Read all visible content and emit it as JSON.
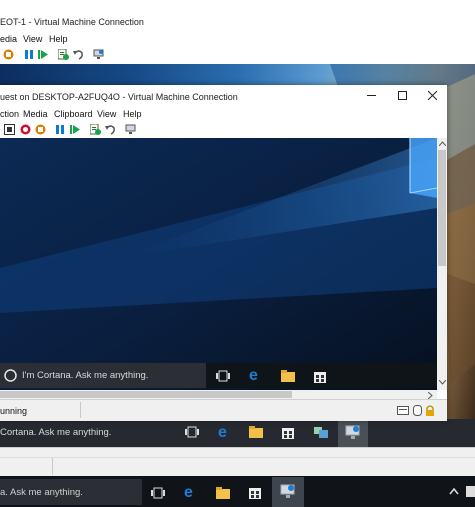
{
  "outer": {
    "title": "EOT-1 - Virtual Machine Connection",
    "menu": [
      "edia",
      "View",
      "Help"
    ],
    "taskbar": {
      "search_text": "Cortana. Ask me anything."
    }
  },
  "inner": {
    "title": "uest on DESKTOP-A2FUQ4O - Virtual Machine Connection",
    "menu": [
      "ction",
      "Media",
      "Clipboard",
      "View",
      "Help"
    ],
    "taskbar": {
      "search_text": "I'm Cortana. Ask me anything."
    },
    "status": "unning"
  },
  "host_taskbar": {
    "search_text": "a. Ask me anything."
  },
  "colors": {
    "pause": "#0b7bd6",
    "start": "#16a34a",
    "stop": "#d0102f",
    "turn_off": "#e07b00",
    "edge": "#1c7ed6",
    "explorer": "#f3c14a"
  }
}
